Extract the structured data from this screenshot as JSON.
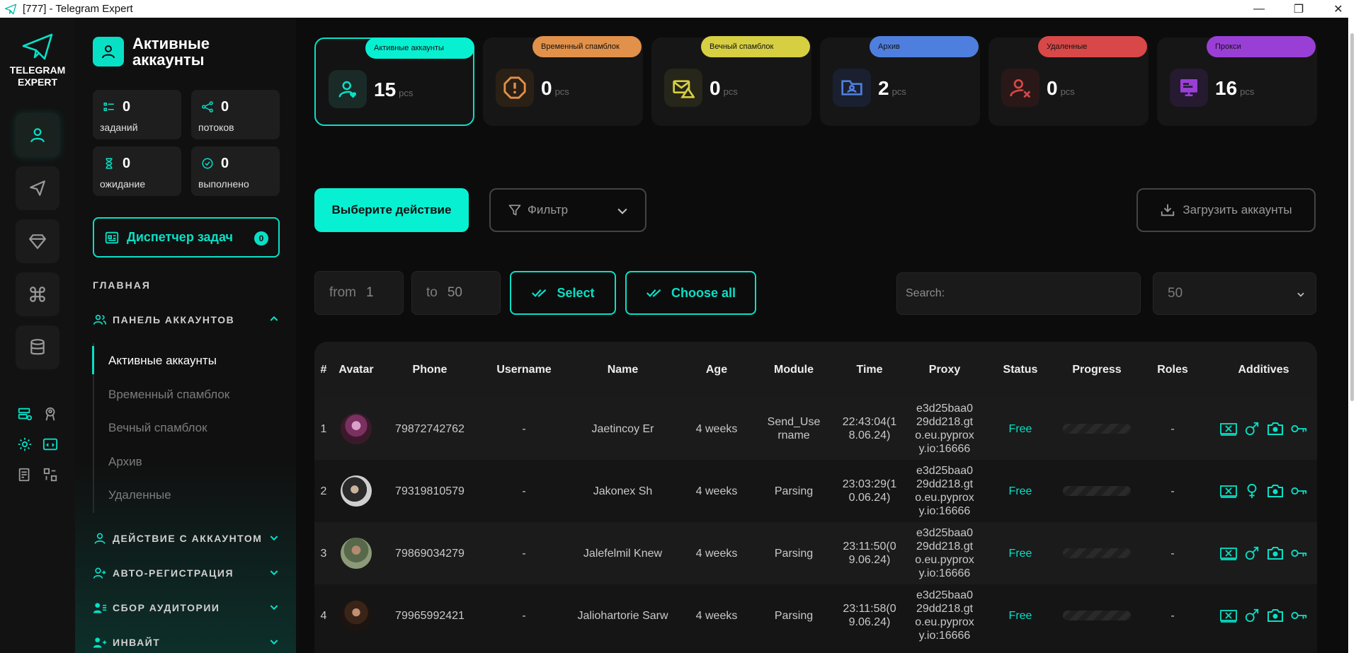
{
  "window": {
    "title": "[777] - Telegram Expert",
    "controls": [
      "—",
      "❐",
      "✕"
    ]
  },
  "logo": {
    "line1": "TELEGRAM",
    "line2": "EXPERT"
  },
  "sidebar": {
    "title_line1": "Активные",
    "title_line2": "аккаунты",
    "stats": [
      {
        "value": "0",
        "label": "заданий"
      },
      {
        "value": "0",
        "label": "потоков"
      },
      {
        "value": "0",
        "label": "ожидание"
      },
      {
        "value": "0",
        "label": "выполнено"
      }
    ],
    "dispatcher": {
      "label": "Диспетчер задач",
      "badge": "0"
    },
    "main_section": "ГЛАВНАЯ",
    "sections": [
      {
        "label": "ПАНЕЛЬ АККАУНТОВ",
        "expanded": true
      },
      {
        "label": "ДЕЙСТВИЕ С АККАУНТОМ",
        "expanded": false
      },
      {
        "label": "АВТО-РЕГИСТРАЦИЯ",
        "expanded": false
      },
      {
        "label": "СБОР АУДИТОРИИ",
        "expanded": false
      },
      {
        "label": "ИНВАЙТ",
        "expanded": false
      }
    ],
    "sub_items": [
      "Активные аккаунты",
      "Временный спамблок",
      "Вечный спамблок",
      "Архив",
      "Удаленные"
    ]
  },
  "cards": [
    {
      "tag": "Активные аккаунты",
      "value": "15",
      "unit": "pcs",
      "color": "#08f0d2"
    },
    {
      "tag": "Временный спамблок",
      "value": "0",
      "unit": "pcs",
      "color": "#e2914a"
    },
    {
      "tag": "Вечный спамблок",
      "value": "0",
      "unit": "pcs",
      "color": "#d7cf42"
    },
    {
      "tag": "Архив",
      "value": "2",
      "unit": "pcs",
      "color": "#4f7fde"
    },
    {
      "tag": "Удаленные",
      "value": "0",
      "unit": "pcs",
      "color": "#d84848"
    },
    {
      "tag": "Прокси",
      "value": "16",
      "unit": "pcs",
      "color": "#9a3fd6"
    }
  ],
  "toolbar": {
    "action_label": "Выберите действие",
    "filter_label": "Фильтр",
    "upload_label": "Загрузить аккаунты",
    "from_label": "from",
    "from_value": "1",
    "to_label": "to",
    "to_value": "50",
    "select_label": "Select",
    "choose_all_label": "Choose all",
    "search_placeholder": "Search:",
    "per_page": "50"
  },
  "table": {
    "headers": [
      "#",
      "Avatar",
      "Phone",
      "Username",
      "Name",
      "Age",
      "Module",
      "Time",
      "Proxy",
      "Status",
      "Progress",
      "Roles",
      "Additives"
    ],
    "rows": [
      {
        "num": "1",
        "phone": "79872742762",
        "username": "-",
        "name": "Jaetincoy Er",
        "age": "4 weeks",
        "module": "Send_Username",
        "time": "22:43:04(18.06.24)",
        "proxy": "e3d25baa029dd218.gto.eu.pyproxy.io:16666",
        "status": "Free",
        "roles": "-",
        "gender_icon": "male-icon"
      },
      {
        "num": "2",
        "phone": "79319810579",
        "username": "-",
        "name": "Jakonex Sh",
        "age": "4 weeks",
        "module": "Parsing",
        "time": "23:03:29(10.06.24)",
        "proxy": "e3d25baa029dd218.gto.eu.pyproxy.io:16666",
        "status": "Free",
        "roles": "-",
        "gender_icon": "female-icon"
      },
      {
        "num": "3",
        "phone": "79869034279",
        "username": "-",
        "name": "Jalefelmil Knew",
        "age": "4 weeks",
        "module": "Parsing",
        "time": "23:11:50(09.06.24)",
        "proxy": "e3d25baa029dd218.gto.eu.pyproxy.io:16666",
        "status": "Free",
        "roles": "-",
        "gender_icon": "male-icon"
      },
      {
        "num": "4",
        "phone": "79965992421",
        "username": "-",
        "name": "Jaliohartorie Sarw",
        "age": "4 weeks",
        "module": "Parsing",
        "time": "23:11:58(09.06.24)",
        "proxy": "e3d25baa029dd218.gto.eu.pyproxy.io:16666",
        "status": "Free",
        "roles": "-",
        "gender_icon": "male-icon"
      }
    ]
  },
  "colors": {
    "accent": "#08e0c6",
    "background": "#0c0c0c",
    "panel": "#101010"
  }
}
